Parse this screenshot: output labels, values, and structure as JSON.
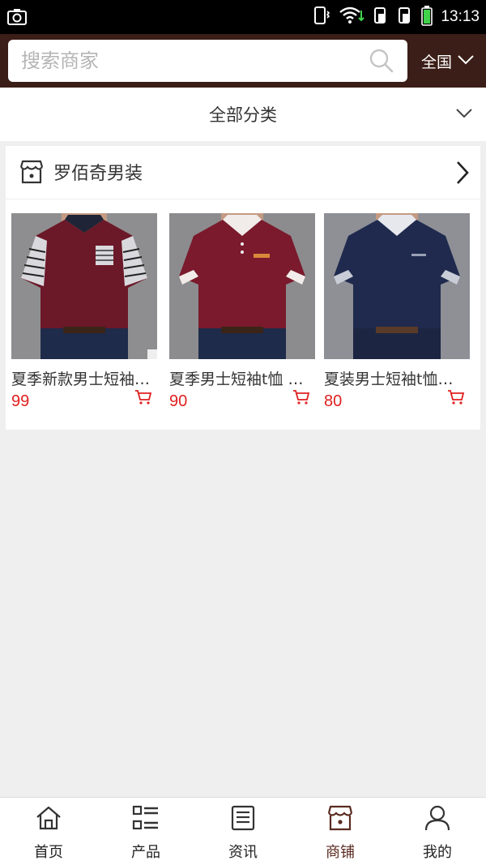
{
  "status_bar": {
    "time": "13:13",
    "icons": [
      "screenshot-icon",
      "vibrate-icon",
      "wifi-icon",
      "sim1-icon",
      "sim2-icon",
      "battery-icon"
    ]
  },
  "header": {
    "search_placeholder": "搜索商家",
    "region_label": "全国"
  },
  "category": {
    "label": "全部分类"
  },
  "shop": {
    "name": "罗佰奇男装",
    "products": [
      {
        "title": "夏季新款男士短袖T恤",
        "price": "99"
      },
      {
        "title": "夏季男士短袖t恤 韩版",
        "price": "90"
      },
      {
        "title": "夏装男士短袖t恤韩版",
        "price": "80"
      }
    ]
  },
  "tabs": [
    {
      "label": "首页",
      "icon": "home-icon"
    },
    {
      "label": "产品",
      "icon": "list-icon"
    },
    {
      "label": "资讯",
      "icon": "news-icon"
    },
    {
      "label": "商铺",
      "icon": "store-icon",
      "active": true
    },
    {
      "label": "我的",
      "icon": "user-icon"
    }
  ],
  "colors": {
    "header_bg": "#3b1e17",
    "price": "#e02020",
    "active_tab": "#5a2a20"
  }
}
